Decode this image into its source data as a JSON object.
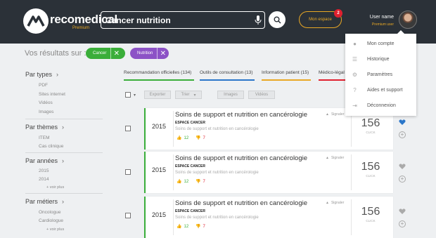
{
  "header": {
    "brand": "recomedical",
    "brand_sub": "Premium",
    "search": {
      "value": "Cancer nutrition"
    },
    "mon_espace_label": "Mon espace",
    "notification_count": "2",
    "user_name": "User name",
    "user_sub": "Premium user"
  },
  "results": {
    "label": "Vos résultats sur :",
    "chips": [
      {
        "label": "Cancer",
        "color": "#3aae3a"
      },
      {
        "label": "Nutrition",
        "color": "#8c52c6"
      }
    ]
  },
  "sidebar": {
    "sections": [
      {
        "title": "Par types",
        "items": [
          "PDF",
          "Sites internet",
          "Vidéos",
          "Images"
        ]
      },
      {
        "title": "Par thèmes",
        "items": [
          "ITEM",
          "Cas clinique"
        ]
      },
      {
        "title": "Par années",
        "items": [
          "2015",
          "2014"
        ],
        "more": "+ voir plus"
      },
      {
        "title": "Par métiers",
        "items": [
          "Oncologue",
          "Cardiologue"
        ],
        "more": "+ voir plus"
      }
    ]
  },
  "tabs": [
    {
      "label": "Recommandation officielles (134)",
      "color": "#3aae3a"
    },
    {
      "label": "Outils de consultation (13)",
      "color": "#2b76c9"
    },
    {
      "label": "Information patient (15)",
      "color": "#e9a825"
    },
    {
      "label": "Médico-légal (",
      "color": "#e0202f"
    }
  ],
  "toolbar": {
    "exporter": "Exporter",
    "trier": "Trier",
    "images": "Images",
    "videos": "Vidéos"
  },
  "cards": [
    {
      "year": "2015",
      "title": "Soins de support et nutrition en cancérologie",
      "label": "ESPACE CANCER",
      "subtitle": "Soins de support et nutrition en cancérologie",
      "up": "12",
      "down": "7",
      "signaler": "Signaler",
      "count": "156",
      "count_label": "CLICK",
      "favorite": true
    },
    {
      "year": "2015",
      "title": "Soins de support et nutrition en cancérologie",
      "label": "ESPACE CANCER",
      "subtitle": "Soins de support et nutrition en cancérologie",
      "up": "12",
      "down": "7",
      "signaler": "Signaler",
      "count": "156",
      "count_label": "CLICK",
      "favorite": false
    },
    {
      "year": "2015",
      "title": "Soins de support et nutrition en cancérologie",
      "label": "ESPACE CANCER",
      "subtitle": "Soins de support et nutrition en cancérologie",
      "up": "12",
      "down": "7",
      "signaler": "Signaler",
      "count": "156",
      "count_label": "CLICK",
      "favorite": false
    }
  ],
  "dropdown": {
    "items": [
      {
        "label": "Mon compte",
        "icon": "user-icon"
      },
      {
        "label": "Historique",
        "icon": "list-icon"
      },
      {
        "label": "Paramètres",
        "icon": "gear-icon"
      },
      {
        "label": "Aides et support",
        "icon": "help-icon"
      },
      {
        "label": "Déconnexion",
        "icon": "logout-icon"
      }
    ]
  },
  "colors": {
    "header_bg": "#2b3138",
    "accent": "#e9a825",
    "green": "#3aae3a",
    "purple": "#8c52c6",
    "blue": "#2b76c9",
    "red": "#e0202f"
  }
}
